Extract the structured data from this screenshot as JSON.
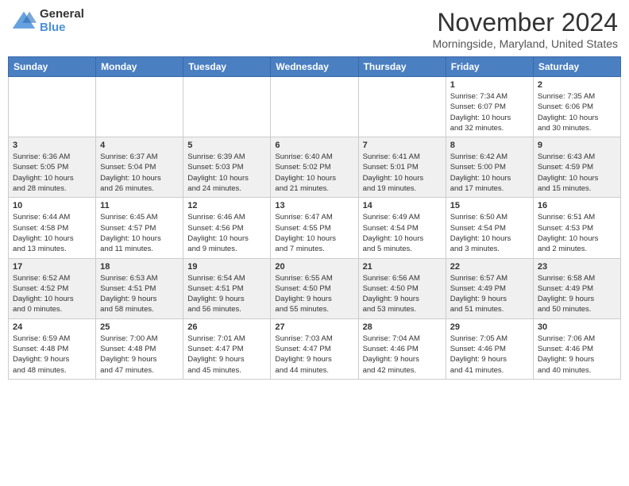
{
  "header": {
    "logo_general": "General",
    "logo_blue": "Blue",
    "month_title": "November 2024",
    "location": "Morningside, Maryland, United States"
  },
  "days_of_week": [
    "Sunday",
    "Monday",
    "Tuesday",
    "Wednesday",
    "Thursday",
    "Friday",
    "Saturday"
  ],
  "weeks": [
    [
      {
        "day": "",
        "info": ""
      },
      {
        "day": "",
        "info": ""
      },
      {
        "day": "",
        "info": ""
      },
      {
        "day": "",
        "info": ""
      },
      {
        "day": "",
        "info": ""
      },
      {
        "day": "1",
        "info": "Sunrise: 7:34 AM\nSunset: 6:07 PM\nDaylight: 10 hours\nand 32 minutes."
      },
      {
        "day": "2",
        "info": "Sunrise: 7:35 AM\nSunset: 6:06 PM\nDaylight: 10 hours\nand 30 minutes."
      }
    ],
    [
      {
        "day": "3",
        "info": "Sunrise: 6:36 AM\nSunset: 5:05 PM\nDaylight: 10 hours\nand 28 minutes."
      },
      {
        "day": "4",
        "info": "Sunrise: 6:37 AM\nSunset: 5:04 PM\nDaylight: 10 hours\nand 26 minutes."
      },
      {
        "day": "5",
        "info": "Sunrise: 6:39 AM\nSunset: 5:03 PM\nDaylight: 10 hours\nand 24 minutes."
      },
      {
        "day": "6",
        "info": "Sunrise: 6:40 AM\nSunset: 5:02 PM\nDaylight: 10 hours\nand 21 minutes."
      },
      {
        "day": "7",
        "info": "Sunrise: 6:41 AM\nSunset: 5:01 PM\nDaylight: 10 hours\nand 19 minutes."
      },
      {
        "day": "8",
        "info": "Sunrise: 6:42 AM\nSunset: 5:00 PM\nDaylight: 10 hours\nand 17 minutes."
      },
      {
        "day": "9",
        "info": "Sunrise: 6:43 AM\nSunset: 4:59 PM\nDaylight: 10 hours\nand 15 minutes."
      }
    ],
    [
      {
        "day": "10",
        "info": "Sunrise: 6:44 AM\nSunset: 4:58 PM\nDaylight: 10 hours\nand 13 minutes."
      },
      {
        "day": "11",
        "info": "Sunrise: 6:45 AM\nSunset: 4:57 PM\nDaylight: 10 hours\nand 11 minutes."
      },
      {
        "day": "12",
        "info": "Sunrise: 6:46 AM\nSunset: 4:56 PM\nDaylight: 10 hours\nand 9 minutes."
      },
      {
        "day": "13",
        "info": "Sunrise: 6:47 AM\nSunset: 4:55 PM\nDaylight: 10 hours\nand 7 minutes."
      },
      {
        "day": "14",
        "info": "Sunrise: 6:49 AM\nSunset: 4:54 PM\nDaylight: 10 hours\nand 5 minutes."
      },
      {
        "day": "15",
        "info": "Sunrise: 6:50 AM\nSunset: 4:54 PM\nDaylight: 10 hours\nand 3 minutes."
      },
      {
        "day": "16",
        "info": "Sunrise: 6:51 AM\nSunset: 4:53 PM\nDaylight: 10 hours\nand 2 minutes."
      }
    ],
    [
      {
        "day": "17",
        "info": "Sunrise: 6:52 AM\nSunset: 4:52 PM\nDaylight: 10 hours\nand 0 minutes."
      },
      {
        "day": "18",
        "info": "Sunrise: 6:53 AM\nSunset: 4:51 PM\nDaylight: 9 hours\nand 58 minutes."
      },
      {
        "day": "19",
        "info": "Sunrise: 6:54 AM\nSunset: 4:51 PM\nDaylight: 9 hours\nand 56 minutes."
      },
      {
        "day": "20",
        "info": "Sunrise: 6:55 AM\nSunset: 4:50 PM\nDaylight: 9 hours\nand 55 minutes."
      },
      {
        "day": "21",
        "info": "Sunrise: 6:56 AM\nSunset: 4:50 PM\nDaylight: 9 hours\nand 53 minutes."
      },
      {
        "day": "22",
        "info": "Sunrise: 6:57 AM\nSunset: 4:49 PM\nDaylight: 9 hours\nand 51 minutes."
      },
      {
        "day": "23",
        "info": "Sunrise: 6:58 AM\nSunset: 4:49 PM\nDaylight: 9 hours\nand 50 minutes."
      }
    ],
    [
      {
        "day": "24",
        "info": "Sunrise: 6:59 AM\nSunset: 4:48 PM\nDaylight: 9 hours\nand 48 minutes."
      },
      {
        "day": "25",
        "info": "Sunrise: 7:00 AM\nSunset: 4:48 PM\nDaylight: 9 hours\nand 47 minutes."
      },
      {
        "day": "26",
        "info": "Sunrise: 7:01 AM\nSunset: 4:47 PM\nDaylight: 9 hours\nand 45 minutes."
      },
      {
        "day": "27",
        "info": "Sunrise: 7:03 AM\nSunset: 4:47 PM\nDaylight: 9 hours\nand 44 minutes."
      },
      {
        "day": "28",
        "info": "Sunrise: 7:04 AM\nSunset: 4:46 PM\nDaylight: 9 hours\nand 42 minutes."
      },
      {
        "day": "29",
        "info": "Sunrise: 7:05 AM\nSunset: 4:46 PM\nDaylight: 9 hours\nand 41 minutes."
      },
      {
        "day": "30",
        "info": "Sunrise: 7:06 AM\nSunset: 4:46 PM\nDaylight: 9 hours\nand 40 minutes."
      }
    ]
  ]
}
